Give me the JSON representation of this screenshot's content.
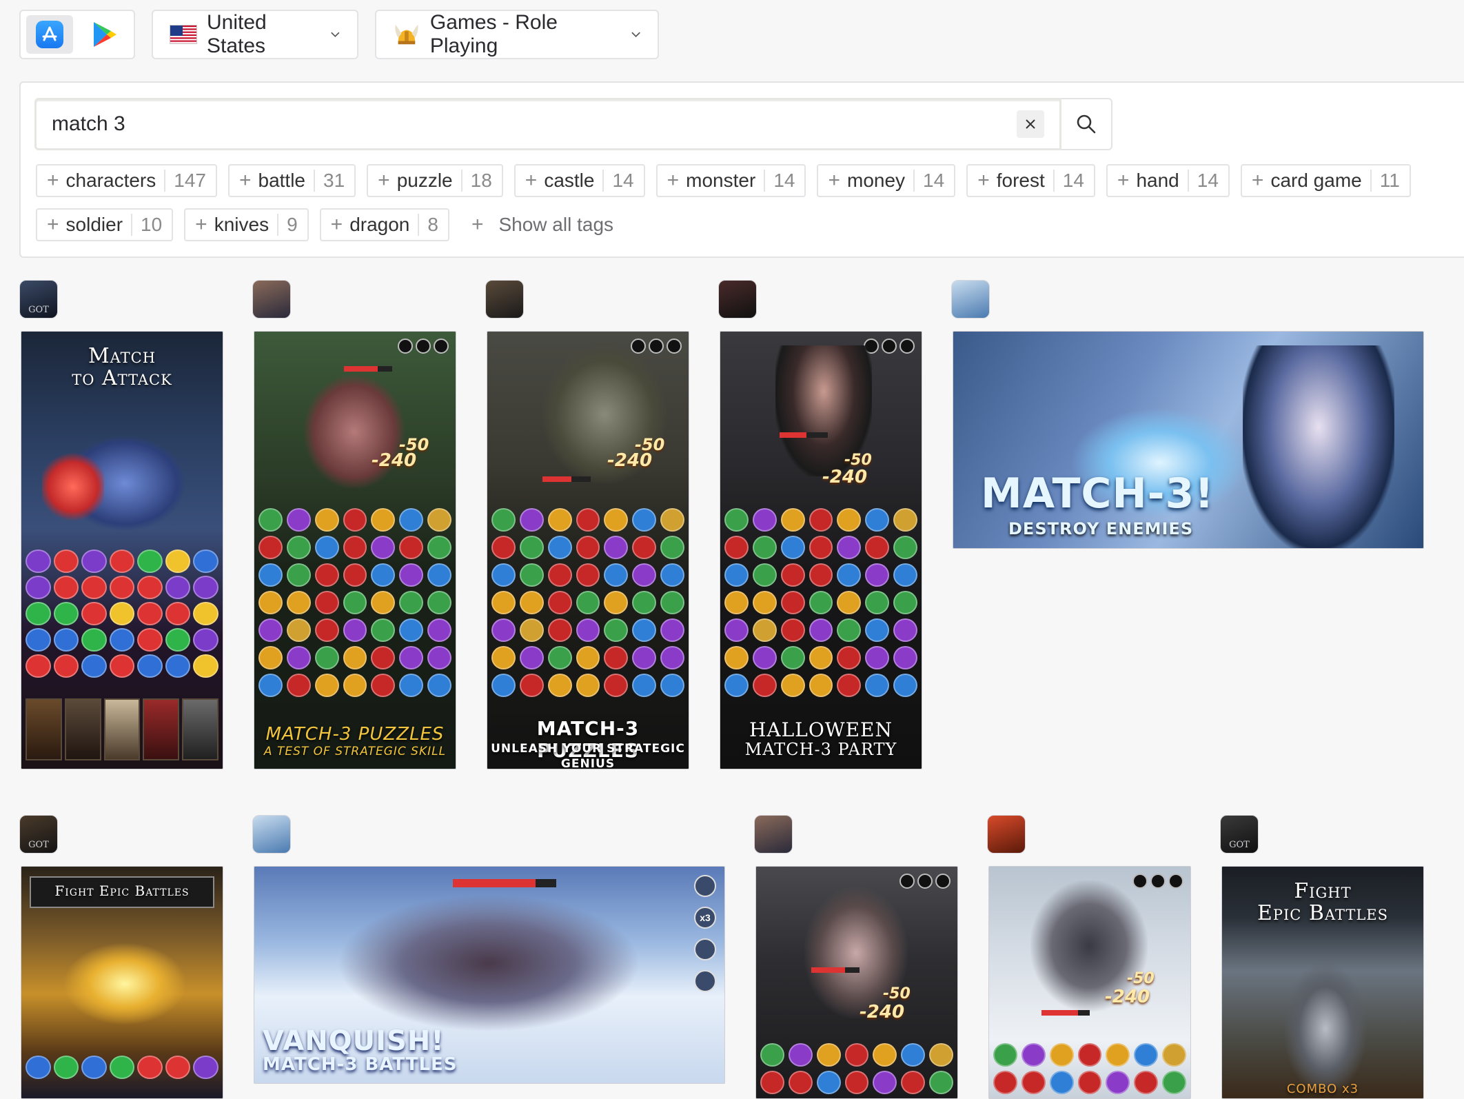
{
  "store_switcher": {
    "app_store_icon": "app-store-icon",
    "google_play_icon": "google-play-icon",
    "active": "app_store"
  },
  "country_dropdown": {
    "value": "United States",
    "flag_icon": "us-flag-icon"
  },
  "category_dropdown": {
    "value": "Games - Role Playing",
    "icon": "viking-helmet-icon"
  },
  "search": {
    "value": "match 3",
    "clear_icon": "close-icon",
    "submit_icon": "search-icon"
  },
  "tags": [
    {
      "label": "characters",
      "count": "147"
    },
    {
      "label": "battle",
      "count": "31"
    },
    {
      "label": "puzzle",
      "count": "18"
    },
    {
      "label": "castle",
      "count": "14"
    },
    {
      "label": "monster",
      "count": "14"
    },
    {
      "label": "money",
      "count": "14"
    },
    {
      "label": "forest",
      "count": "14"
    },
    {
      "label": "hand",
      "count": "14"
    },
    {
      "label": "card game",
      "count": "11"
    },
    {
      "label": "soldier",
      "count": "10"
    },
    {
      "label": "knives",
      "count": "9"
    },
    {
      "label": "dragon",
      "count": "8"
    }
  ],
  "show_all_tags": "Show all tags",
  "screenshots": [
    {
      "caption_1": "Match",
      "caption_2": "to Attack"
    },
    {
      "caption_1": "MATCH-3 PUZZLES",
      "caption_2": "A TEST OF STRATEGIC SKILL",
      "dmg_1": "-50",
      "dmg_2": "-240"
    },
    {
      "caption_1": "MATCH-3 PUZZLES",
      "caption_2": "UNLEASH YOUR STRATEGIC GENIUS",
      "dmg_1": "-50",
      "dmg_2": "-240"
    },
    {
      "caption_1": "HALLOWEEN",
      "caption_2": "MATCH-3 PARTY",
      "dmg_1": "-50",
      "dmg_2": "-240"
    },
    {
      "caption_1": "MATCH-3!",
      "caption_2": "DESTROY ENEMIES"
    },
    {
      "caption_1": "Fight Epic Battles"
    },
    {
      "caption_1": "VANQUISH!",
      "caption_2": "MATCH-3 BATTLES",
      "hud": "x3"
    },
    {
      "dmg_1": "-50",
      "dmg_2": "-240"
    },
    {
      "dmg_1": "-50",
      "dmg_2": "-240"
    },
    {
      "caption_1": "Fight",
      "caption_2": "Epic Battles",
      "caption_3": "COMBO x3"
    }
  ],
  "app_icon_labels": {
    "got": "GOT"
  },
  "colors": {
    "accent_blue": "#1978f0",
    "border": "#e3e3e6",
    "background": "#f7f7f8"
  }
}
